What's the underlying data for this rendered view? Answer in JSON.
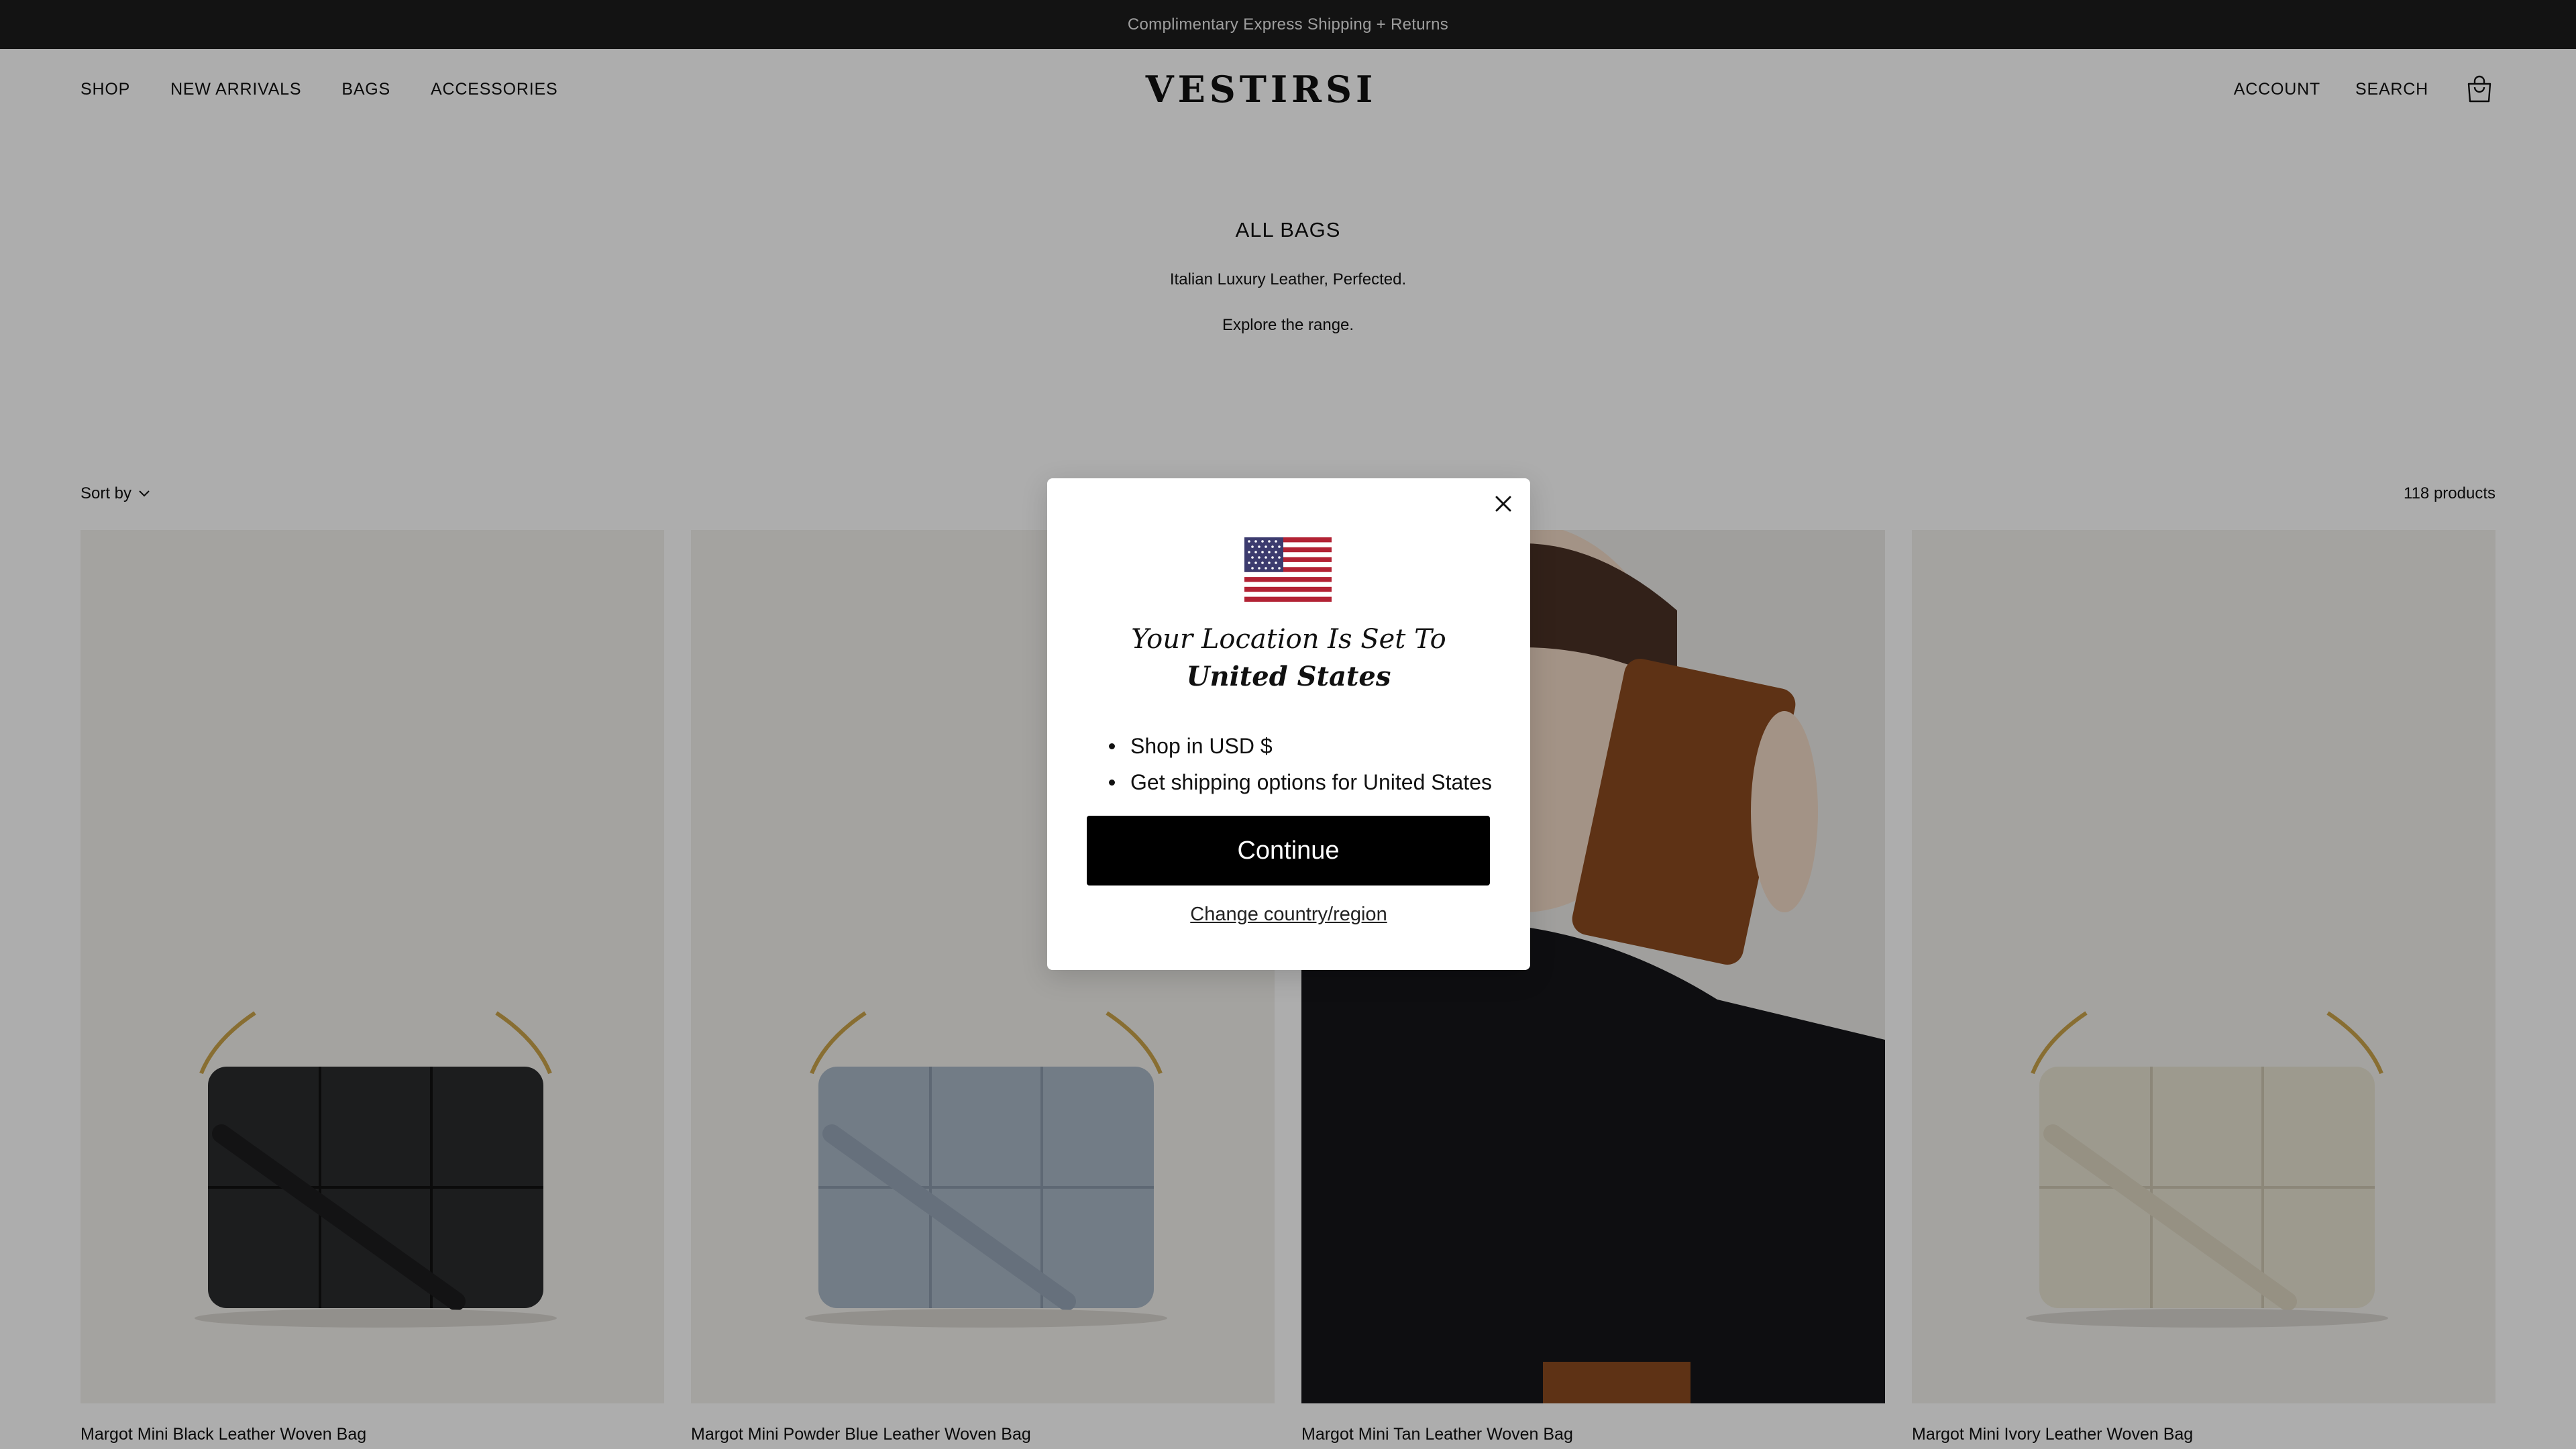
{
  "announcement": "Complimentary Express Shipping + Returns",
  "header": {
    "logo": "VESTIRSI",
    "nav_left": [
      "SHOP",
      "NEW ARRIVALS",
      "BAGS",
      "ACCESSORIES"
    ],
    "nav_right": [
      "ACCOUNT",
      "SEARCH"
    ]
  },
  "collection": {
    "title": "ALL BAGS",
    "tagline": "Italian Luxury Leather, Perfected.",
    "subline": "Explore the range."
  },
  "toolbar": {
    "sort_label": "Sort by",
    "product_count": "118 products"
  },
  "products": [
    {
      "name": "Margot Mini Black Leather Woven Bag",
      "color": "#2a2b2d"
    },
    {
      "name": "Margot Mini Powder Blue Leather Woven Bag",
      "color": "#a9b7c6"
    },
    {
      "name": "Margot Mini Tan Leather Woven Bag",
      "color": "#8b4a1f"
    },
    {
      "name": "Margot Mini Ivory Leather Woven Bag",
      "color": "#e8e3d2"
    }
  ],
  "modal": {
    "heading_prefix": "Your Location Is Set To ",
    "heading_country": "United States",
    "bullets": [
      "Shop in USD $",
      "Get shipping options for United States"
    ],
    "continue_label": "Continue",
    "change_label": "Change country/region"
  },
  "colors": {
    "announcement_bg": "#1c1c1c",
    "overlay": "rgba(0,0,0,0.32)",
    "button": "#000000",
    "product_bg": "#f2f0ec"
  }
}
